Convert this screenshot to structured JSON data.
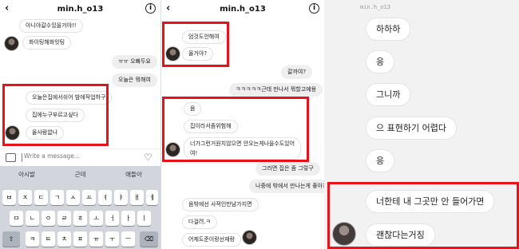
{
  "panel1": {
    "username": "min.h_o13",
    "messages": [
      "아니야갈수있을거야!!",
      "화이팅해화잇팅",
      "ㅠㅠ 오빠두요",
      "오늘은 뭐해여",
      "오늘은집에서쉬어 밤에작업하구",
      "집에누구부르고싶다",
      "올사람없나"
    ],
    "composer_placeholder": "Write a message...",
    "suggestions": [
      "아시발",
      "근데",
      "애들아"
    ],
    "keys_row1": [
      "ㅂ",
      "ㅈ",
      "ㄷ",
      "ㄱ",
      "ㅅ",
      "ㅛ",
      "ㅕ",
      "ㅑ",
      "ㅐ",
      "ㅔ"
    ],
    "keys_row2": [
      "ㅁ",
      "ㄴ",
      "ㅇ",
      "ㄹ",
      "ㅎ",
      "ㅗ",
      "ㅓ",
      "ㅏ",
      "ㅣ"
    ],
    "keys_row3": [
      "ㅋ",
      "ㅌ",
      "ㅊ",
      "ㅍ",
      "ㅠ",
      "ㅜ",
      "ㅡ"
    ],
    "back_icon": "‹",
    "info_icon": "i",
    "heart_icon": "♡",
    "shift_icon": "⇧",
    "delete_icon": "⌫"
  },
  "panel2": {
    "username": "min.h_o13",
    "messages": [
      "엄것도안해여",
      "올거야?",
      "갈까여?",
      "ㅋㅋㅋㅋㅋ근데 만나서 뭐할고예용",
      "음",
      "집이라서좀위험해",
      "너가그런거원치않으면 안오는게나을수도있어",
      "여!",
      "그러면 집은 좀 그렇구",
      "나중에 밖에서 만나는게 좋아??",
      "음밖에선 사적인만남가지면",
      "다걸려.ㅋ",
      "어제도준이랑선재랑"
    ],
    "back_icon": "‹",
    "info_icon": "i"
  },
  "panel3": {
    "username": "min.h_o13",
    "messages": [
      "하하하",
      "응",
      "그니까",
      "으 표현하기 어렵다",
      "응",
      "너한테 내 그곳만 안 들어가면",
      "괜찮다는거징"
    ]
  },
  "colors": {
    "highlight": "#e8121b",
    "bubble_grey": "#efefef",
    "keyboard": "#d2d5db",
    "accent": "#3897f0"
  }
}
